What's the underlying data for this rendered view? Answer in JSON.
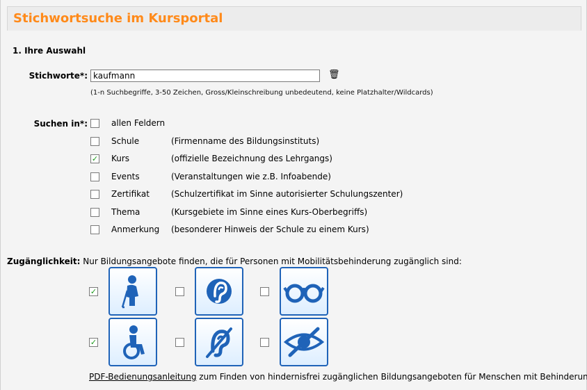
{
  "page_title": "Stichwortsuche im Kursportal",
  "section_title": "1. Ihre Auswahl",
  "keywords": {
    "label": "Stichworte*:",
    "value": "kaufmann",
    "hint": "(1-n Suchbegriffe, 3-50 Zeichen, Gross/Kleinschreibung unbedeutend, keine Platzhalter/Wildcards)",
    "clear_icon": "trash-icon"
  },
  "search_in": {
    "label": "Suchen in*:",
    "options": [
      {
        "label": "allen Feldern",
        "description": "",
        "checked": false
      },
      {
        "label": "Schule",
        "description": "(Firmenname des Bildungsinstituts)",
        "checked": false
      },
      {
        "label": "Kurs",
        "description": "(offizielle Bezeichnung des Lehrgangs)",
        "checked": true
      },
      {
        "label": "Events",
        "description": "(Veranstaltungen wie z.B. Infoabende)",
        "checked": false
      },
      {
        "label": "Zertifikat",
        "description": "(Schulzertifikat im Sinne autorisierter Schulungszenter)",
        "checked": false
      },
      {
        "label": "Thema",
        "description": "(Kursgebiete im Sinne eines Kurs-Oberbegriffs)",
        "checked": false
      },
      {
        "label": "Anmerkung",
        "description": "(besonderer Hinweis der Schule zu einem Kurs)",
        "checked": false
      }
    ]
  },
  "accessibility": {
    "label": "Zugänglichkeit:",
    "description": "Nur Bildungsangebote finden, die für Personen mit Mobilitätsbehinderung zugänglich sind:",
    "icons": [
      {
        "icon": "blind-person-cane-icon",
        "checked": true
      },
      {
        "icon": "hearing-ear-icon",
        "checked": false
      },
      {
        "icon": "low-vision-glasses-icon",
        "checked": false
      },
      {
        "icon": "wheelchair-icon",
        "checked": true
      },
      {
        "icon": "deaf-ear-icon",
        "checked": false
      },
      {
        "icon": "blind-eye-icon",
        "checked": false
      }
    ],
    "footer_link": "PDF-Bedienungsanleitung",
    "footer_text": " zum Finden von hindernisfrei zugänglichen Bildungsangeboten für Menschen mit Behinderung."
  },
  "colors": {
    "title": "#ff8a1a",
    "icon_blue": "#1f63b8",
    "check": "#1c9a1c"
  }
}
